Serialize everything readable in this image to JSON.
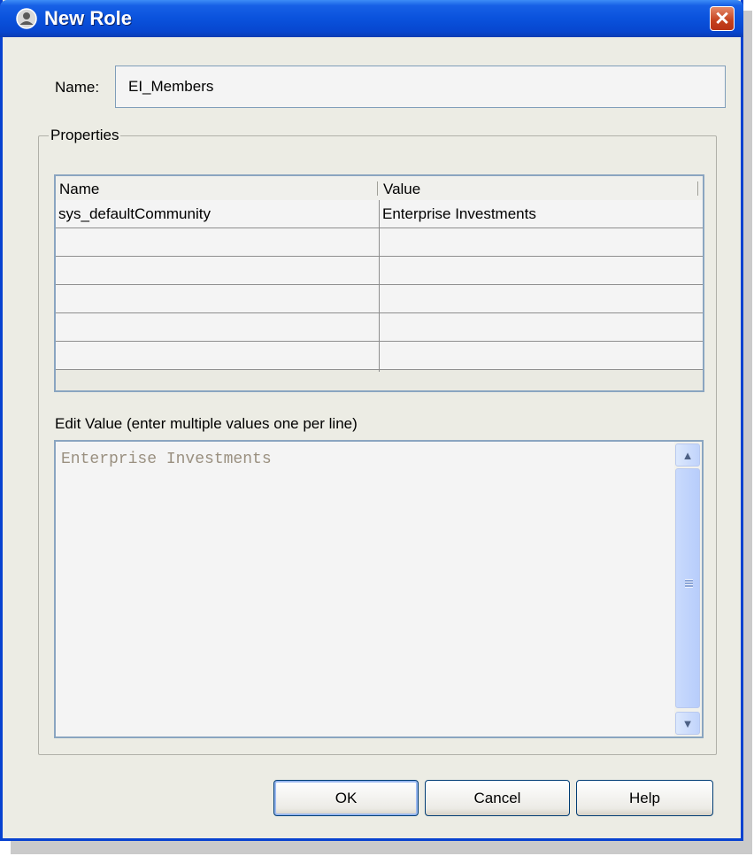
{
  "window": {
    "title": "New Role",
    "close_glyph": "✕",
    "icon": "role-person-icon"
  },
  "name_field": {
    "label": "Name:",
    "value": "EI_Members"
  },
  "properties": {
    "legend": "Properties",
    "table": {
      "columns": [
        "Name",
        "Value"
      ],
      "rows": [
        {
          "name": "sys_defaultCommunity",
          "value": "Enterprise Investments"
        },
        {
          "name": "",
          "value": ""
        },
        {
          "name": "",
          "value": ""
        },
        {
          "name": "",
          "value": ""
        },
        {
          "name": "",
          "value": ""
        },
        {
          "name": "",
          "value": ""
        }
      ]
    },
    "edit_value": {
      "label": "Edit Value (enter multiple values one per line)",
      "text": "Enterprise Investments"
    }
  },
  "buttons": {
    "ok": "OK",
    "cancel": "Cancel",
    "help": "Help"
  },
  "scrollbar": {
    "up_glyph": "▲",
    "down_glyph": "▼"
  }
}
